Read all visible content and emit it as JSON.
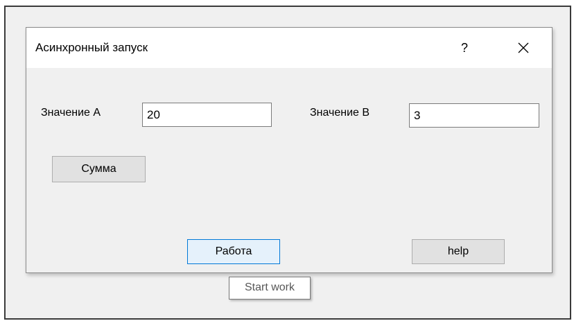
{
  "window": {
    "title": "Асинхронный запуск",
    "help_label": "?"
  },
  "form": {
    "label_a": "Значение А",
    "value_a": "20",
    "label_b": "Значение В",
    "value_b": "3"
  },
  "buttons": {
    "sum_label": "Сумма",
    "work_label": "Работа",
    "help_label": "help"
  },
  "tooltip": {
    "text": "Start work"
  },
  "colors": {
    "focus_border": "#0078d7",
    "focus_fill": "#e5f1fb"
  },
  "icons": {
    "close": "close-icon"
  }
}
